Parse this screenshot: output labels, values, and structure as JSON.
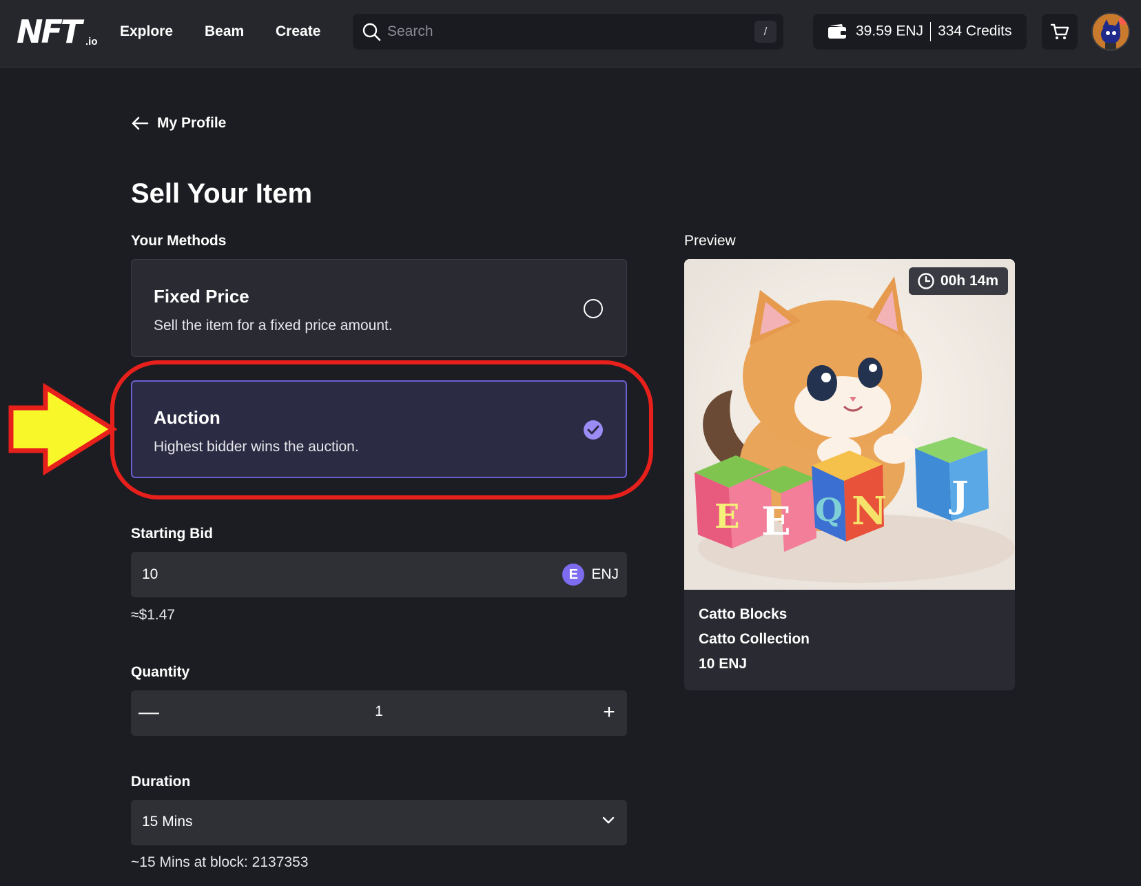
{
  "header": {
    "logo_text": "NFT",
    "logo_suffix": ".io",
    "nav": [
      "Explore",
      "Beam",
      "Create"
    ],
    "search_placeholder": "Search",
    "search_shortcut": "/",
    "wallet": {
      "balance": "39.59 ENJ",
      "credits": "334 Credits"
    }
  },
  "back_link": "My Profile",
  "page_title": "Sell Your Item",
  "methods_label": "Your Methods",
  "methods": [
    {
      "title": "Fixed Price",
      "description": "Sell the item for a fixed price amount.",
      "selected": false
    },
    {
      "title": "Auction",
      "description": "Highest bidder wins the auction.",
      "selected": true
    }
  ],
  "starting_bid": {
    "label": "Starting Bid",
    "value": "10",
    "currency": "ENJ",
    "usd_estimate": "≈$1.47"
  },
  "quantity": {
    "label": "Quantity",
    "value": "1",
    "minus": "—",
    "plus": "+"
  },
  "duration": {
    "label": "Duration",
    "selected": "15 Mins",
    "note": "~15 Mins at block: 2137353"
  },
  "preview": {
    "label": "Preview",
    "timer": "00h 14m",
    "item_name": "Catto Blocks",
    "collection": "Catto Collection",
    "price": "10 ENJ",
    "block_letters": [
      "E",
      "E",
      "Q",
      "N",
      "J"
    ]
  },
  "colors": {
    "background": "#1c1d22",
    "header": "#26272d",
    "accent": "#6b5fd6",
    "highlight": "#e8201c",
    "arrow": "#f7f72a"
  }
}
